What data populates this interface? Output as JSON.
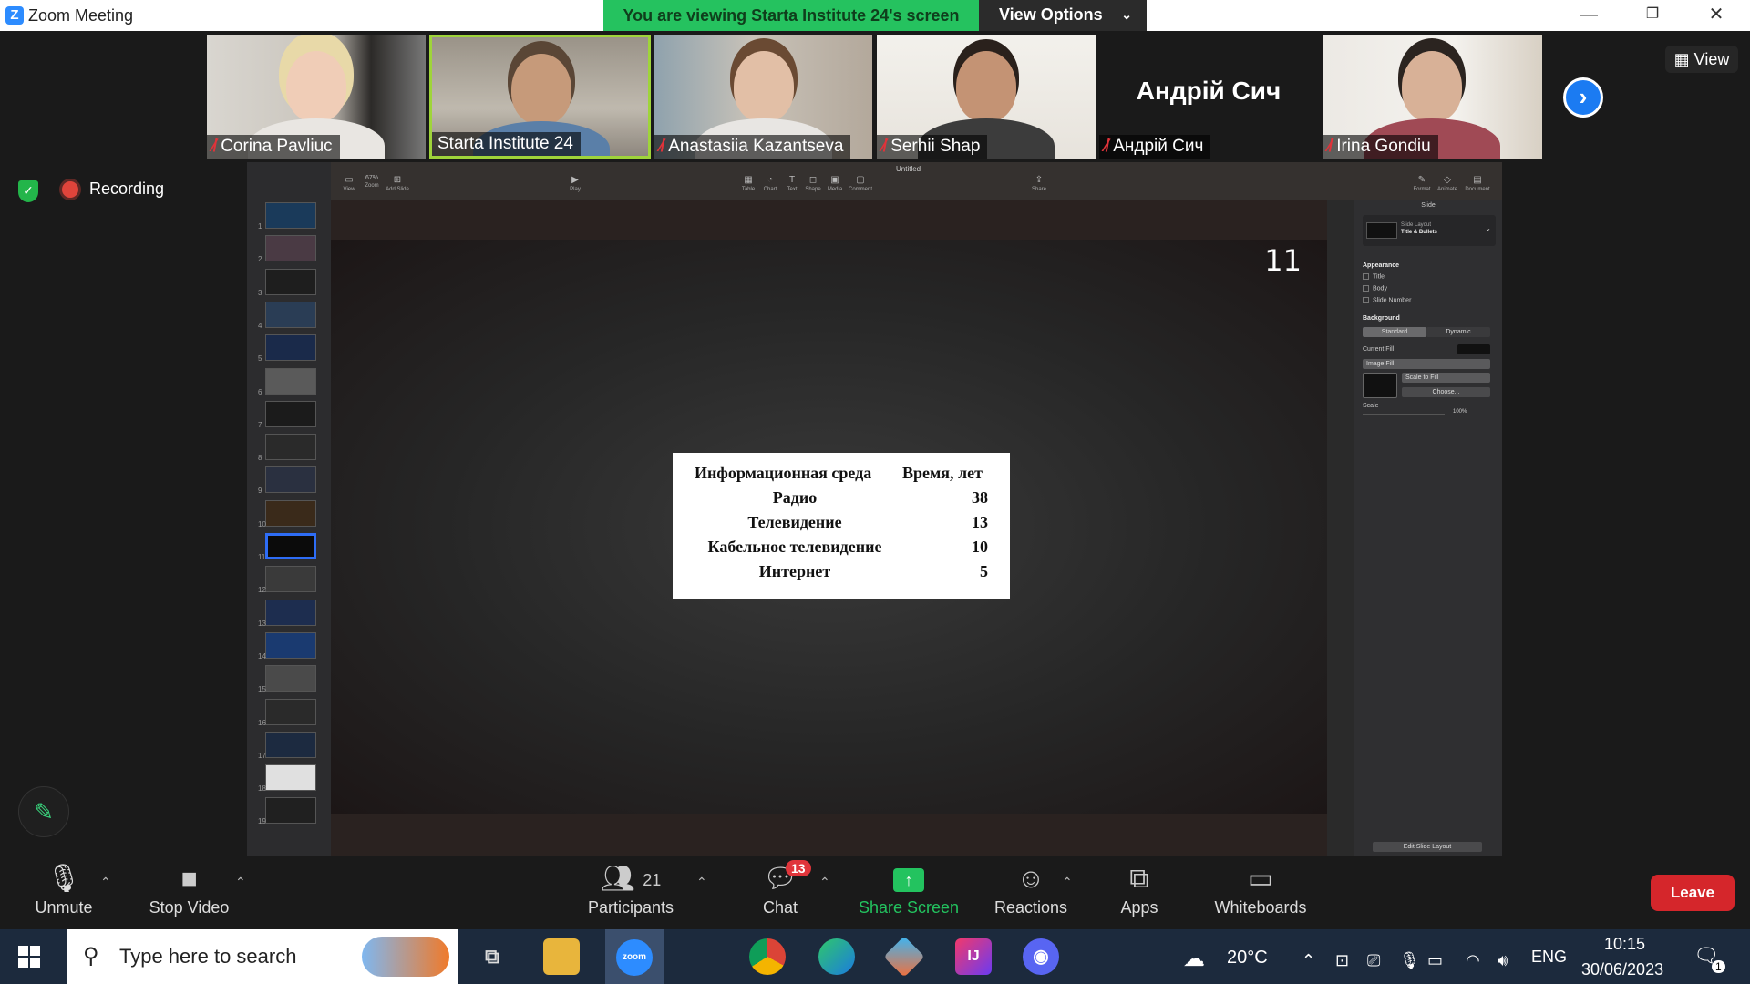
{
  "window": {
    "title": "Zoom Meeting"
  },
  "banner": {
    "text": "You are viewing Starta Institute 24's screen",
    "view_options": "View Options"
  },
  "participants_strip": [
    {
      "name": "Corina Pavliuc",
      "muted": true
    },
    {
      "name": "Starta Institute 24",
      "muted": false
    },
    {
      "name": "Anastasiia Kazantseva",
      "muted": true
    },
    {
      "name": "Serhii Shap",
      "muted": true
    },
    {
      "name": "Андрій Сич",
      "muted": true,
      "video": false
    },
    {
      "name": "Irina Gondiu",
      "muted": true
    }
  ],
  "view_button": "View",
  "recording": {
    "label": "Recording"
  },
  "shared": {
    "doc_title": "Untitled",
    "toolbar": {
      "view": "View",
      "zoom": "67%",
      "zoom_label": "Zoom",
      "add_slide": "Add Slide",
      "play": "Play",
      "table": "Table",
      "chart": "Chart",
      "text": "Text",
      "shape": "Shape",
      "media": "Media",
      "comment": "Comment",
      "share": "Share",
      "format": "Format",
      "animate": "Animate",
      "document": "Document"
    },
    "slide_numbers": [
      "1",
      "2",
      "3",
      "4",
      "5",
      "6",
      "7",
      "8",
      "9",
      "10",
      "11",
      "12",
      "13",
      "14",
      "15",
      "16",
      "17",
      "18",
      "19"
    ],
    "selected_slide": 11,
    "slide_number_display": "11",
    "table": {
      "headers": [
        "Информационная среда",
        "Время, лет"
      ],
      "rows": [
        [
          "Радио",
          "38"
        ],
        [
          "Телевидение",
          "13"
        ],
        [
          "Кабельное телевидение",
          "10"
        ],
        [
          "Интернет",
          "5"
        ]
      ]
    },
    "inspector": {
      "tab": "Slide",
      "layout_label": "Slide Layout",
      "layout_value": "Title & Bullets",
      "appearance": "Appearance",
      "appearance_items": [
        "Title",
        "Body",
        "Slide Number"
      ],
      "background": "Background",
      "bg_standard": "Standard",
      "bg_dynamic": "Dynamic",
      "current_fill": "Current Fill",
      "image_fill": "Image Fill",
      "scale_to_fill": "Scale to Fill",
      "choose": "Choose...",
      "scale": "Scale",
      "scale_value": "100%",
      "edit_layout": "Edit Slide Layout"
    }
  },
  "controls": {
    "unmute": "Unmute",
    "stop_video": "Stop Video",
    "participants": "Participants",
    "participants_count": "21",
    "chat": "Chat",
    "chat_badge": "13",
    "share_screen": "Share Screen",
    "reactions": "Reactions",
    "apps": "Apps",
    "whiteboards": "Whiteboards",
    "leave": "Leave"
  },
  "taskbar": {
    "search_placeholder": "Type here to search",
    "zoom_label": "zoom",
    "weather": "20°C",
    "language": "ENG",
    "time": "10:15",
    "date": "30/06/2023",
    "notifications": "1"
  }
}
